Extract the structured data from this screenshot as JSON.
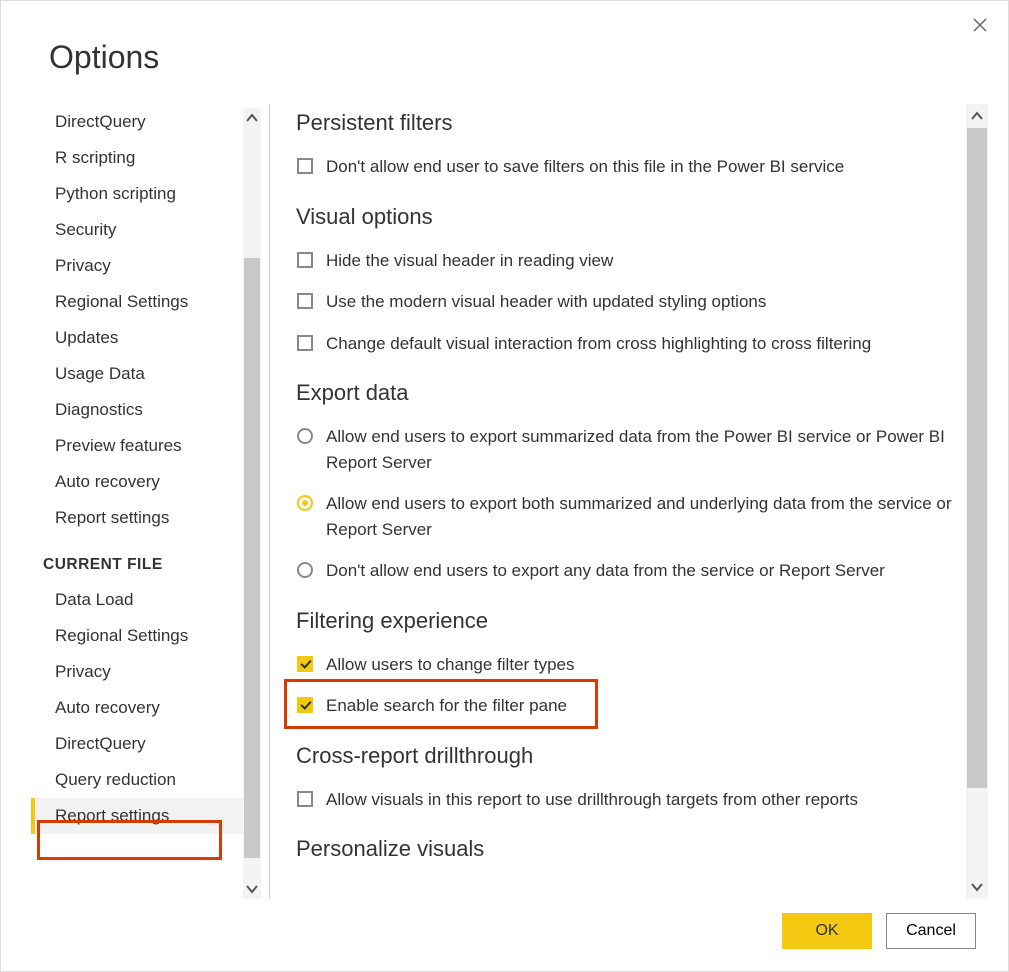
{
  "dialog": {
    "title": "Options",
    "ok_label": "OK",
    "cancel_label": "Cancel"
  },
  "sidebar": {
    "global": [
      "DirectQuery",
      "R scripting",
      "Python scripting",
      "Security",
      "Privacy",
      "Regional Settings",
      "Updates",
      "Usage Data",
      "Diagnostics",
      "Preview features",
      "Auto recovery",
      "Report settings"
    ],
    "current_file_header": "CURRENT FILE",
    "current_file": [
      "Data Load",
      "Regional Settings",
      "Privacy",
      "Auto recovery",
      "DirectQuery",
      "Query reduction",
      "Report settings"
    ],
    "selected": "Report settings"
  },
  "main": {
    "sections": {
      "persistent": {
        "title": "Persistent filters",
        "items": {
          "disallow_save": "Don't allow end user to save filters on this file in the Power BI service"
        }
      },
      "visual": {
        "title": "Visual options",
        "items": {
          "hide_header": "Hide the visual header in reading view",
          "modern_header": "Use the modern visual header with updated styling options",
          "cross_filter": "Change default visual interaction from cross highlighting to cross filtering"
        }
      },
      "export": {
        "title": "Export data",
        "items": {
          "summarized": "Allow end users to export summarized data from the Power BI service or Power BI Report Server",
          "both": "Allow end users to export both summarized and underlying data from the service or Report Server",
          "none": "Don't allow end users to export any data from the service or Report Server"
        }
      },
      "filtering": {
        "title": "Filtering experience",
        "items": {
          "change_types": "Allow users to change filter types",
          "enable_search": "Enable search for the filter pane"
        }
      },
      "crossreport": {
        "title": "Cross-report drillthrough",
        "items": {
          "allow": "Allow visuals in this report to use drillthrough targets from other reports"
        }
      },
      "personalize": {
        "title": "Personalize visuals"
      }
    }
  }
}
